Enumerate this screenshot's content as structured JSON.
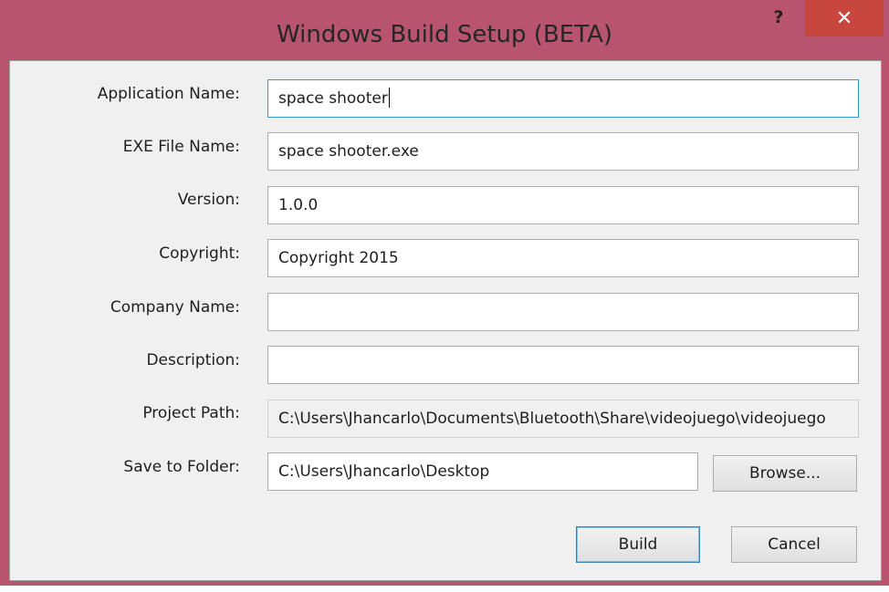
{
  "window": {
    "title": "Windows Build Setup (BETA)",
    "help_label": "?",
    "close_label": "✕"
  },
  "form": {
    "application_name": {
      "label": "Application Name:",
      "value": "space shooter"
    },
    "exe_file_name": {
      "label": "EXE File Name:",
      "value": "space shooter.exe"
    },
    "version": {
      "label": "Version:",
      "value": "1.0.0"
    },
    "copyright": {
      "label": "Copyright:",
      "value": "Copyright 2015"
    },
    "company_name": {
      "label": "Company Name:",
      "value": ""
    },
    "description": {
      "label": "Description:",
      "value": ""
    },
    "project_path": {
      "label": "Project Path:",
      "value": "C:\\Users\\Jhancarlo\\Documents\\Bluetooth\\Share\\videojuego\\videojuego"
    },
    "save_to_folder": {
      "label": "Save to Folder:",
      "value": "C:\\Users\\Jhancarlo\\Desktop"
    }
  },
  "buttons": {
    "browse": "Browse...",
    "build": "Build",
    "cancel": "Cancel"
  },
  "colors": {
    "titlebar": "#b8546f",
    "close_button": "#c7473e",
    "client_bg": "#f0f0f0",
    "focus_border": "#3399d6"
  }
}
